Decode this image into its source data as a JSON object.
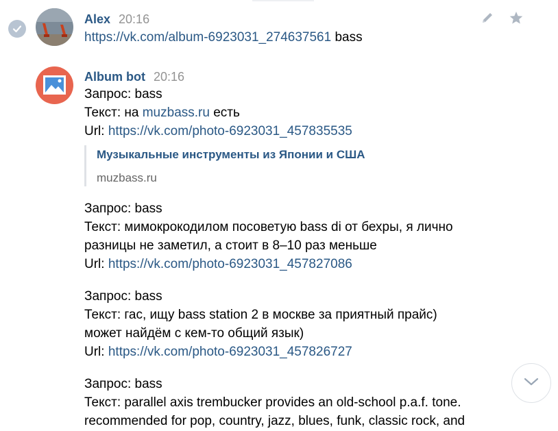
{
  "messages": [
    {
      "author": "Alex",
      "time": "20:16",
      "link": "https://vk.com/album-6923031_274637561",
      "text_after": "bass"
    },
    {
      "author": "Album bot",
      "time": "20:16",
      "entries": [
        {
          "query_label": "Запрос: bass",
          "text_prefix": "Текст: на",
          "text_link": "muzbass.ru",
          "text_suffix": "есть",
          "url_label": "Url:",
          "url": "https://vk.com/photo-6923031_457835535",
          "preview": {
            "title": "Музыкальные инструменты из Японии и США",
            "domain": "muzbass.ru"
          }
        },
        {
          "query_label": "Запрос: bass",
          "text_line1": "Текст: мимокрокодилом посоветую bass di от бехры, я лично",
          "text_line2": "разницы не заметил, а стоит в 8–10 раз меньше",
          "url_label": "Url:",
          "url": "https://vk.com/photo-6923031_457827086"
        },
        {
          "query_label": "Запрос: bass",
          "text_line1": "Текст: гас, ищу bass station 2 в москве за приятный прайс)",
          "text_line2": "может найдём с кем-то общий язык)",
          "url_label": "Url:",
          "url": "https://vk.com/photo-6923031_457826727"
        },
        {
          "query_label": "Запрос: bass",
          "text_line1": "Текст: parallel axis trembucker provides an old-school p.a.f. tone.",
          "text_line2": "recommended for pop, country, jazz, blues, funk, classic rock, and"
        }
      ]
    }
  ],
  "colors": {
    "link": "#2a5885",
    "time": "#939393",
    "bot_avatar_bg": "#e8654f",
    "check_bg": "#b8c4d2"
  },
  "icons": [
    "check-circle-icon",
    "pencil-icon",
    "star-icon",
    "image-icon",
    "chevron-down-icon"
  ]
}
